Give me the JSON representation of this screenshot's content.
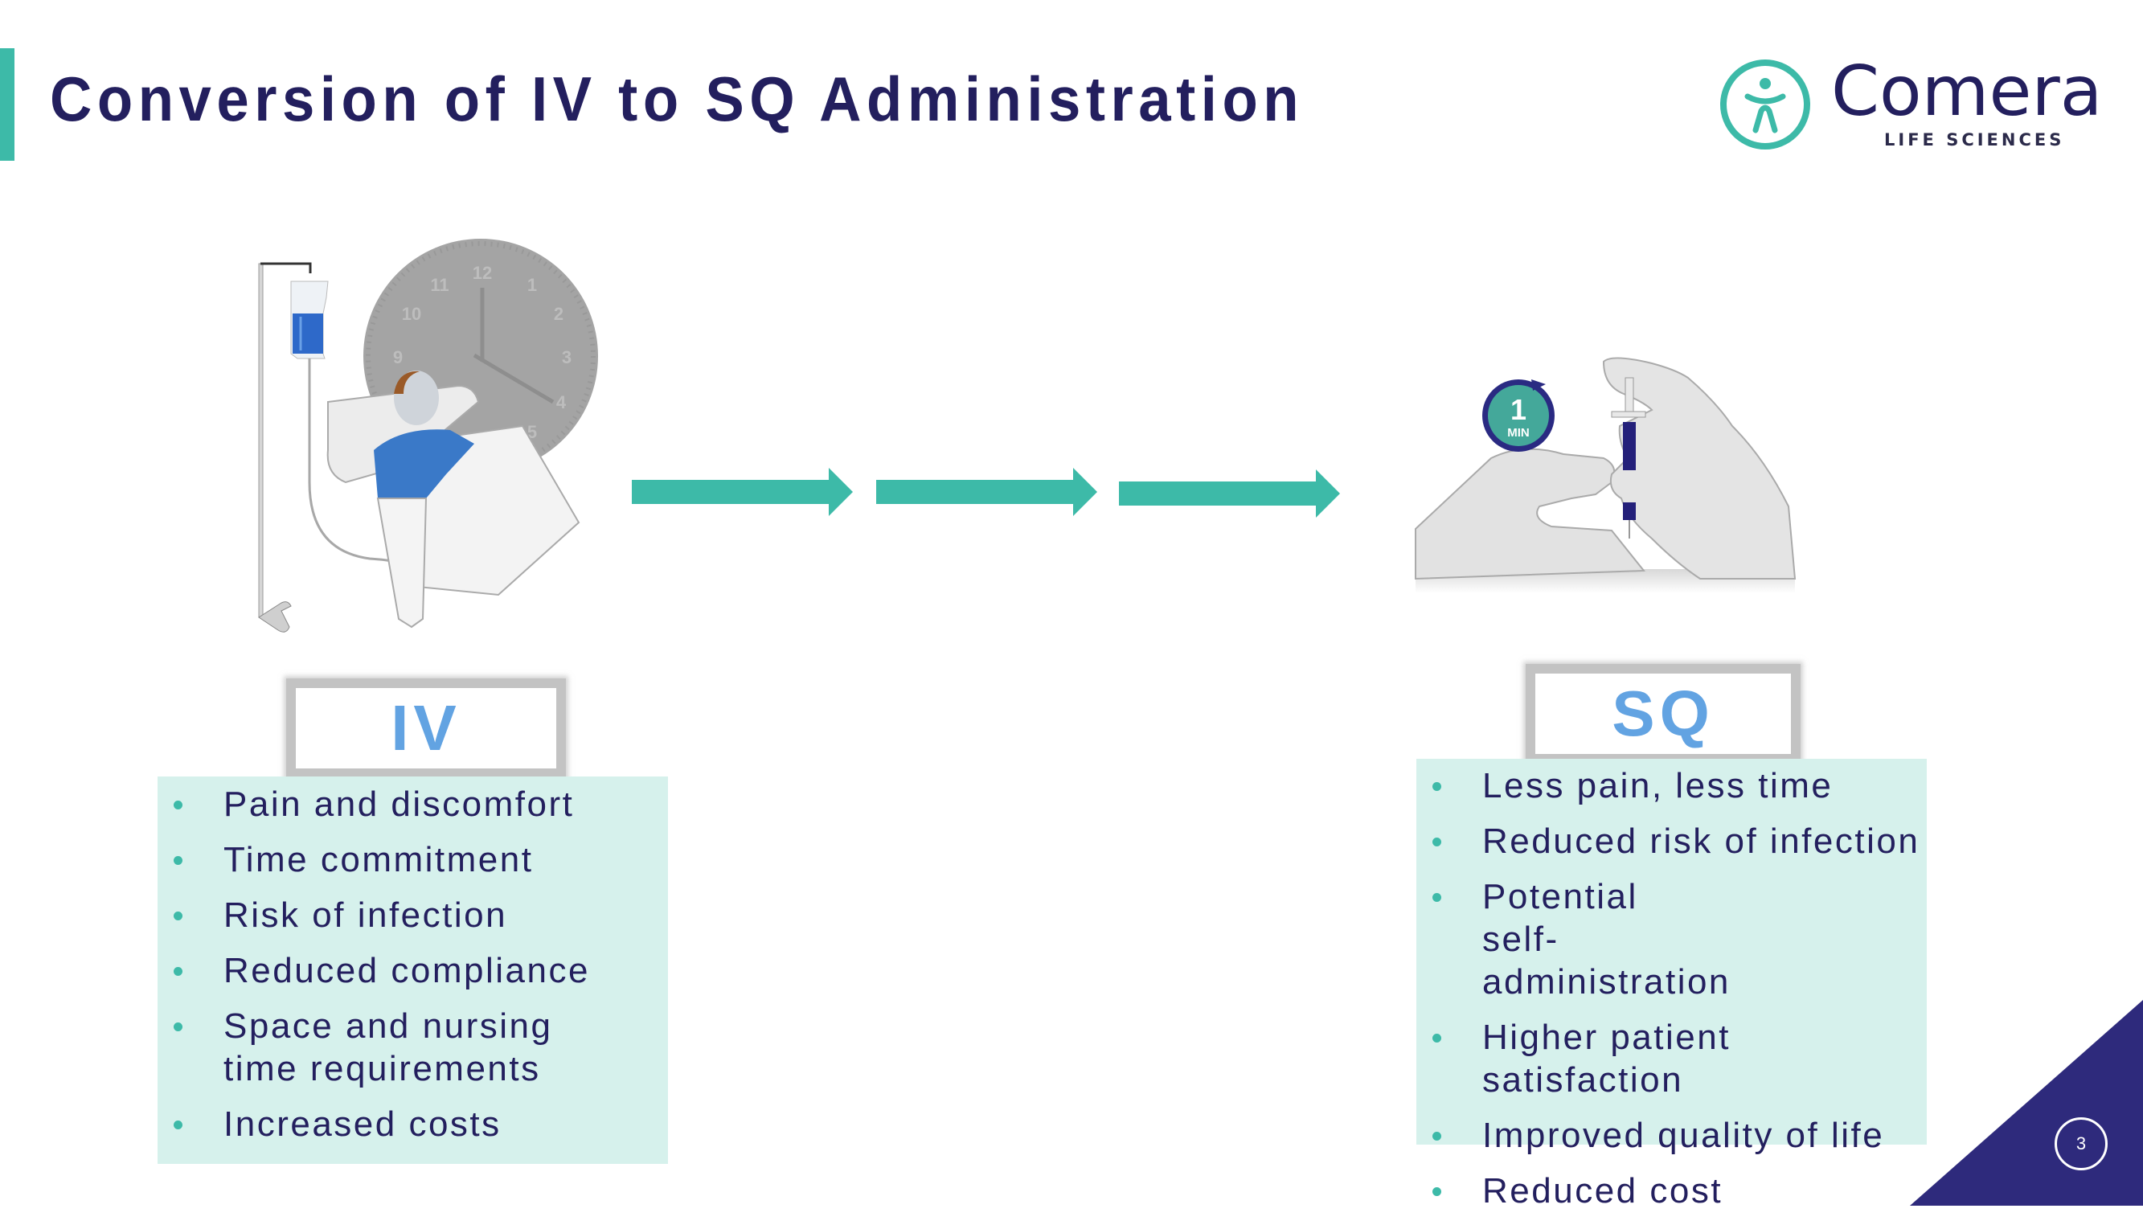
{
  "slide": {
    "title": "Conversion of IV to SQ Administration",
    "page_number": "3"
  },
  "logo": {
    "name": "Comera",
    "subtitle": "LIFE SCIENCES"
  },
  "illustrations": {
    "iv": {
      "description": "Patient lying in bed receiving IV drip with wall clock behind",
      "clock_numbers": [
        "12",
        "1",
        "2",
        "3",
        "4",
        "5",
        "9",
        "10",
        "11"
      ]
    },
    "sq": {
      "description": "Hands administering subcutaneous injection with syringe",
      "timer_value": "1",
      "timer_unit": "MIN"
    }
  },
  "iv": {
    "label": "IV",
    "items": [
      "Pain and discomfort",
      "Time commitment",
      "Risk of infection",
      "Reduced compliance",
      "Space and nursing time requirements",
      "Increased costs"
    ]
  },
  "sq": {
    "label": "SQ",
    "items": [
      "Less pain, less time",
      "Reduced risk of infection",
      "Potential self-administration",
      "Higher patient satisfaction",
      "Improved quality of life",
      "Reduced cost"
    ]
  },
  "colors": {
    "title": "#231f5e",
    "accent": "#3dbaa8",
    "label_text": "#62a3e2",
    "panel_bg": "#d6f1ec",
    "corner": "#2e2a7c"
  }
}
